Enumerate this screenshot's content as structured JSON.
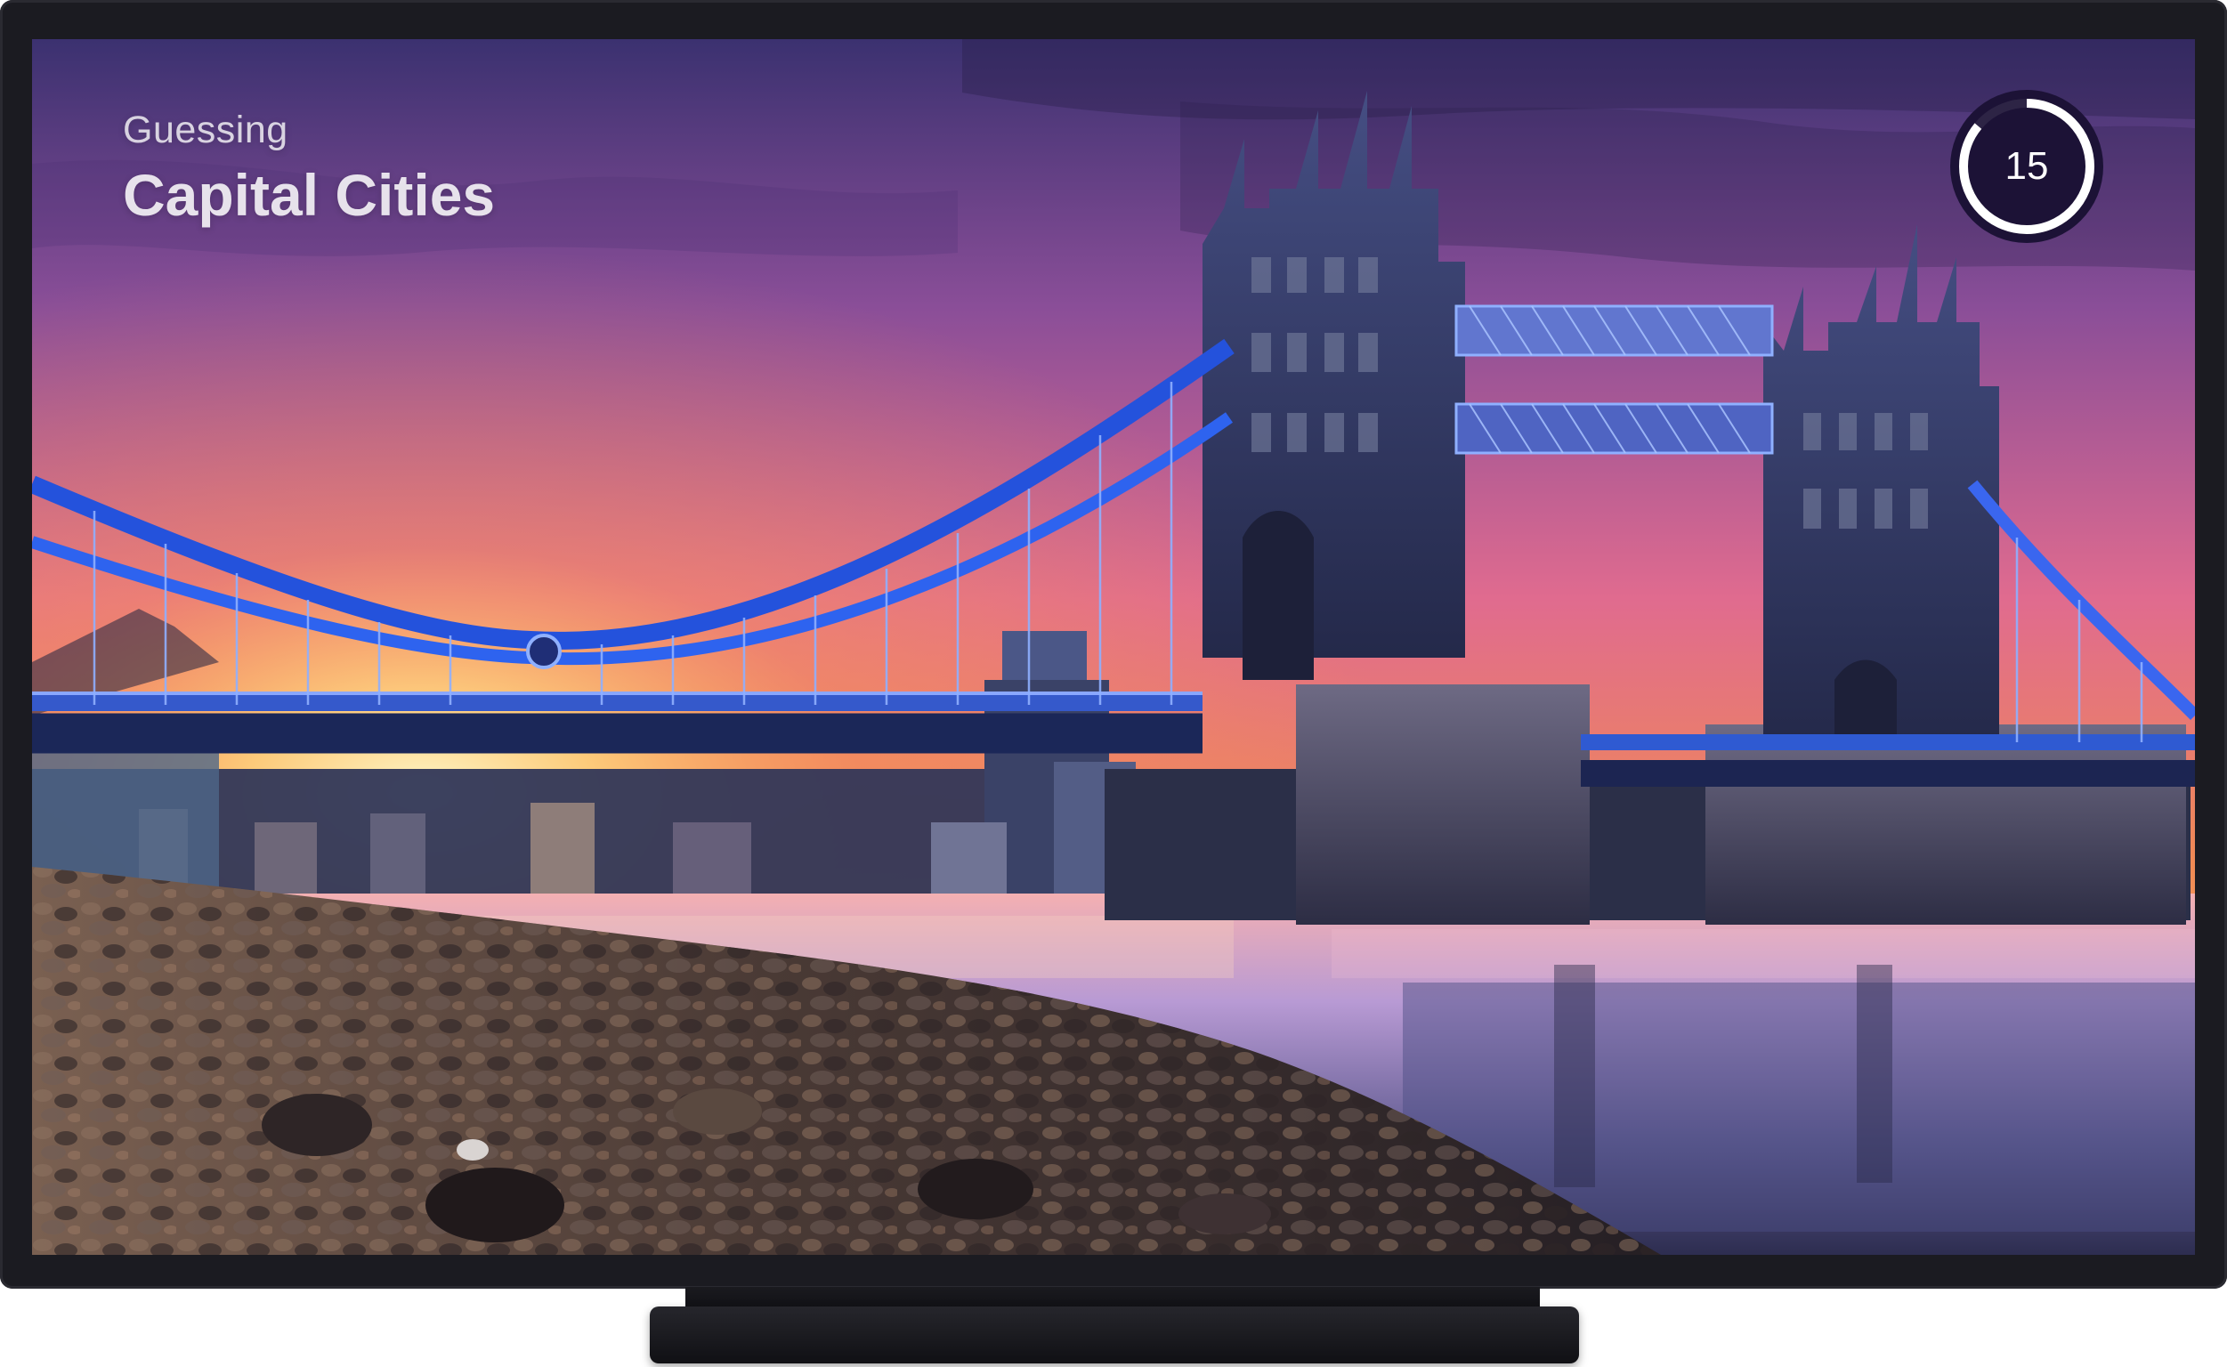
{
  "game": {
    "mode_label": "Guessing",
    "category_title": "Capital Cities"
  },
  "timer": {
    "seconds_remaining": "15",
    "progress_fraction": 0.86,
    "ring_color": "#ffffff",
    "background_color": "#1c1236"
  },
  "device": {
    "frame_color": "#1b1b21"
  },
  "scene": {
    "sky_colors": [
      "#3b3170",
      "#8a4e98",
      "#e06b8f",
      "#f08a54",
      "#ffd27a"
    ],
    "bridge_color": "#2f6dff",
    "tower_color": "#4d567d",
    "water_color": "#b59ad1",
    "foreground_color": "#4a3c35"
  }
}
